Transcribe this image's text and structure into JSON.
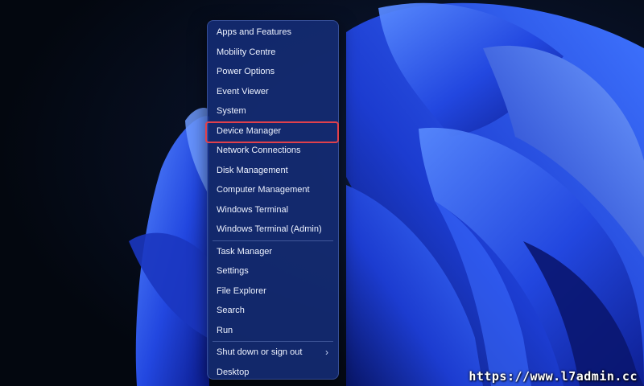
{
  "colors": {
    "menu_background": "#142c76",
    "highlight_border": "#e0404c",
    "wallpaper_blue": "#2a52e8"
  },
  "context_menu": {
    "groups": [
      [
        {
          "label": "Apps and Features"
        },
        {
          "label": "Mobility Centre"
        },
        {
          "label": "Power Options"
        },
        {
          "label": "Event Viewer"
        },
        {
          "label": "System"
        },
        {
          "label": "Device Manager",
          "highlighted": true
        },
        {
          "label": "Network Connections"
        },
        {
          "label": "Disk Management"
        },
        {
          "label": "Computer Management"
        },
        {
          "label": "Windows Terminal"
        },
        {
          "label": "Windows Terminal (Admin)"
        }
      ],
      [
        {
          "label": "Task Manager"
        },
        {
          "label": "Settings"
        },
        {
          "label": "File Explorer"
        },
        {
          "label": "Search"
        },
        {
          "label": "Run"
        }
      ],
      [
        {
          "label": "Shut down or sign out",
          "submenu": true,
          "submenu_icon": "chevron-right-icon"
        },
        {
          "label": "Desktop"
        }
      ]
    ]
  },
  "watermark": {
    "text": "https://www.l7admin.cc"
  }
}
